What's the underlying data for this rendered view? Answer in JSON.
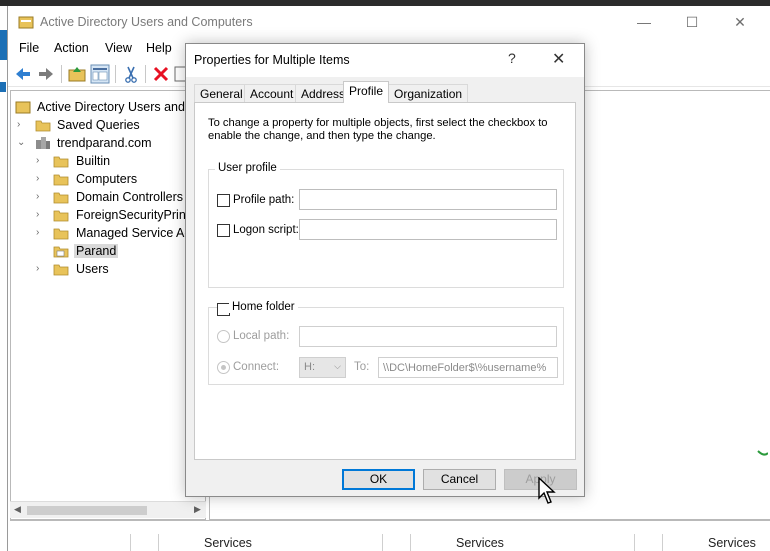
{
  "window": {
    "title": "Active Directory Users and Computers",
    "minimize_glyph": "—",
    "maximize_glyph": "☐",
    "close_glyph": "✕"
  },
  "menu": [
    "File",
    "Action",
    "View",
    "Help"
  ],
  "toolbar_icons": [
    "back-arrow-icon",
    "forward-arrow-icon",
    "up-folder-icon",
    "show-hide-tree-icon",
    "cut-icon",
    "delete-icon"
  ],
  "tree": [
    {
      "label": "Active Directory Users and Co",
      "level": 0,
      "expander": "",
      "icon": "ad-root-icon"
    },
    {
      "label": "Saved Queries",
      "level": 1,
      "expander": "›",
      "icon": "folder-icon"
    },
    {
      "label": "trendparand.com",
      "level": 1,
      "expander": "⌄",
      "icon": "domain-icon"
    },
    {
      "label": "Builtin",
      "level": 2,
      "expander": "›",
      "icon": "folder-icon"
    },
    {
      "label": "Computers",
      "level": 2,
      "expander": "›",
      "icon": "folder-icon"
    },
    {
      "label": "Domain Controllers",
      "level": 2,
      "expander": "›",
      "icon": "folder-icon"
    },
    {
      "label": "ForeignSecurityPrinci",
      "level": 2,
      "expander": "›",
      "icon": "folder-icon"
    },
    {
      "label": "Managed Service Acc",
      "level": 2,
      "expander": "›",
      "icon": "folder-icon"
    },
    {
      "label": "Parand",
      "level": 2,
      "expander": "",
      "icon": "ou-icon",
      "selected": true
    },
    {
      "label": "Users",
      "level": 2,
      "expander": "›",
      "icon": "folder-icon"
    }
  ],
  "services_row": [
    "Services",
    "Services",
    "Services"
  ],
  "dialog": {
    "title": "Properties for Multiple Items",
    "help_glyph": "?",
    "close_glyph": "✕",
    "tabs": [
      "General",
      "Account",
      "Address",
      "Profile",
      "Organization"
    ],
    "active_tab": "Profile",
    "intro": "To change a property for multiple objects, first select the checkbox to enable the change, and then type the change.",
    "user_profile": {
      "group_title": "User profile",
      "profile_path_label": "Profile path:",
      "profile_path_value": "",
      "logon_script_label": "Logon script:",
      "logon_script_value": ""
    },
    "home_folder": {
      "group_title": "Home folder",
      "local_path_label": "Local path:",
      "local_path_value": "",
      "connect_label": "Connect:",
      "drive_value": "H:",
      "to_label": "To:",
      "to_value": "\\\\DC\\HomeFolder$\\%username%"
    },
    "buttons": {
      "ok": "OK",
      "cancel": "Cancel",
      "apply": "Apply"
    }
  },
  "colors": {
    "accent_blue": "#0078d7",
    "delete_red": "#e81123",
    "folder_yellow": "#e8c35a"
  }
}
